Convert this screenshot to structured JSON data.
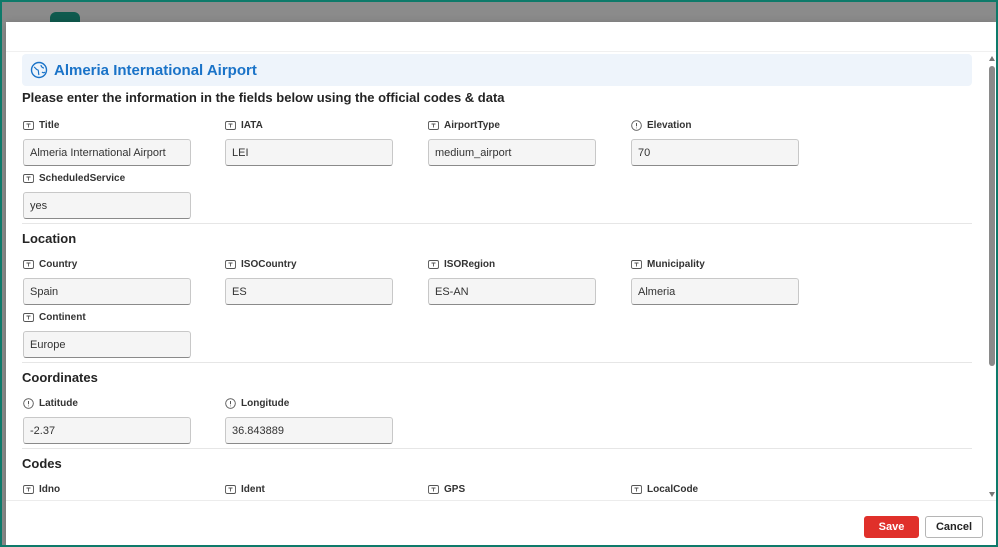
{
  "banner": {
    "title": "Almeria International Airport",
    "icon": "globe-icon"
  },
  "instructions": "Please enter the information in the fields below using the official codes & data",
  "sections": {
    "location": "Location",
    "coordinates": "Coordinates",
    "codes": "Codes"
  },
  "fields": {
    "title": {
      "label": "Title",
      "value": "Almeria International Airport",
      "icon": "text-field-icon"
    },
    "iata": {
      "label": "IATA",
      "value": "LEI",
      "icon": "text-field-icon"
    },
    "airport_type": {
      "label": "AirportType",
      "value": "medium_airport",
      "icon": "text-field-icon"
    },
    "elevation": {
      "label": "Elevation",
      "value": "70",
      "icon": "number-field-icon"
    },
    "scheduled_service": {
      "label": "ScheduledService",
      "value": "yes",
      "icon": "text-field-icon"
    },
    "country": {
      "label": "Country",
      "value": "Spain",
      "icon": "text-field-icon"
    },
    "iso_country": {
      "label": "ISOCountry",
      "value": "ES",
      "icon": "text-field-icon"
    },
    "iso_region": {
      "label": "ISORegion",
      "value": "ES-AN",
      "icon": "text-field-icon"
    },
    "municipality": {
      "label": "Municipality",
      "value": "Almeria",
      "icon": "text-field-icon"
    },
    "continent": {
      "label": "Continent",
      "value": "Europe",
      "icon": "text-field-icon"
    },
    "latitude": {
      "label": "Latitude",
      "value": "-2.37",
      "icon": "number-field-icon"
    },
    "longitude": {
      "label": "Longitude",
      "value": "36.843889",
      "icon": "number-field-icon"
    },
    "idno": {
      "label": "Idno",
      "value": "",
      "icon": "text-field-icon"
    },
    "ident": {
      "label": "Ident",
      "value": "",
      "icon": "text-field-icon"
    },
    "gps": {
      "label": "GPS",
      "value": "",
      "icon": "text-field-icon"
    },
    "local_code": {
      "label": "LocalCode",
      "value": "",
      "icon": "text-field-icon"
    }
  },
  "footer": {
    "save_label": "Save",
    "cancel_label": "Cancel"
  },
  "colors": {
    "accent": "#1a73c8",
    "save": "#e0302a",
    "frame": "#0e7a6a"
  }
}
